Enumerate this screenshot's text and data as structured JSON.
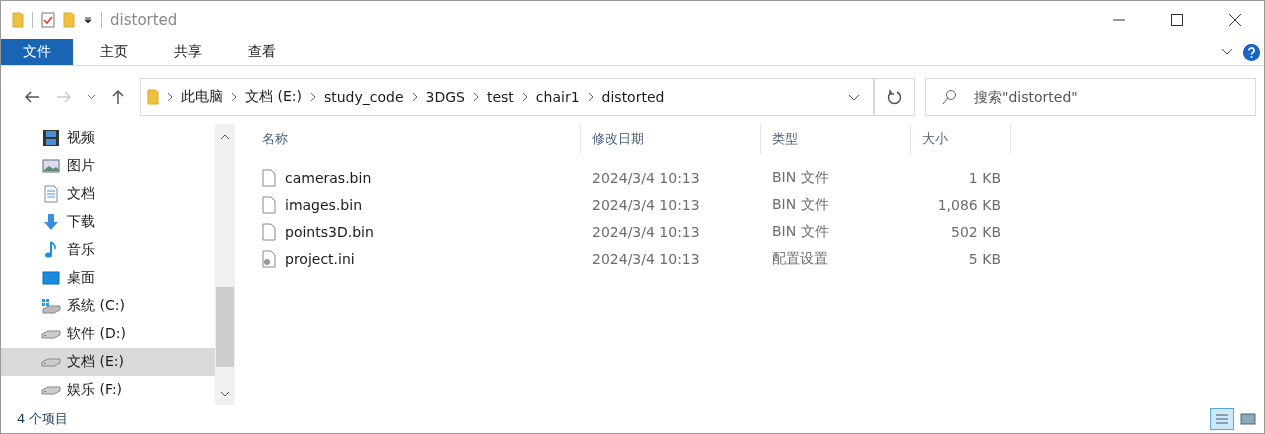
{
  "window": {
    "title": "distorted"
  },
  "ribbon_tabs": [
    {
      "label": "文件",
      "selected": true
    },
    {
      "label": "主页",
      "selected": false
    },
    {
      "label": "共享",
      "selected": false
    },
    {
      "label": "查看",
      "selected": false
    }
  ],
  "address": {
    "path": [
      "此电脑",
      "文档 (E:)",
      "study_code",
      "3DGS",
      "test",
      "chair1",
      "distorted"
    ]
  },
  "search": {
    "placeholder": "搜索\"distorted\""
  },
  "sidebar": {
    "items": [
      {
        "label": "视频",
        "kind": "video",
        "selected": false
      },
      {
        "label": "图片",
        "kind": "pictures",
        "selected": false
      },
      {
        "label": "文档",
        "kind": "documents",
        "selected": false
      },
      {
        "label": "下载",
        "kind": "downloads",
        "selected": false
      },
      {
        "label": "音乐",
        "kind": "music",
        "selected": false
      },
      {
        "label": "桌面",
        "kind": "desktop",
        "selected": false
      },
      {
        "label": "系统 (C:)",
        "kind": "system-drive",
        "selected": false
      },
      {
        "label": "软件 (D:)",
        "kind": "drive",
        "selected": false
      },
      {
        "label": "文档 (E:)",
        "kind": "drive",
        "selected": true
      },
      {
        "label": "娱乐 (F:)",
        "kind": "drive",
        "selected": false
      }
    ]
  },
  "table": {
    "columns": [
      "名称",
      "修改日期",
      "类型",
      "大小"
    ],
    "rows": [
      {
        "name": "cameras.bin",
        "kind": "file",
        "date": "2024/3/4 10:13",
        "type": "BIN 文件",
        "size": "1 KB"
      },
      {
        "name": "images.bin",
        "kind": "file",
        "date": "2024/3/4 10:13",
        "type": "BIN 文件",
        "size": "1,086 KB"
      },
      {
        "name": "points3D.bin",
        "kind": "file",
        "date": "2024/3/4 10:13",
        "type": "BIN 文件",
        "size": "502 KB"
      },
      {
        "name": "project.ini",
        "kind": "settings",
        "date": "2024/3/4 10:13",
        "type": "配置设置",
        "size": "5 KB"
      }
    ]
  },
  "status_bar": {
    "count": "4 个项目",
    "views": [
      {
        "kind": "details",
        "selected": true
      },
      {
        "kind": "large-icons",
        "selected": false
      }
    ]
  }
}
